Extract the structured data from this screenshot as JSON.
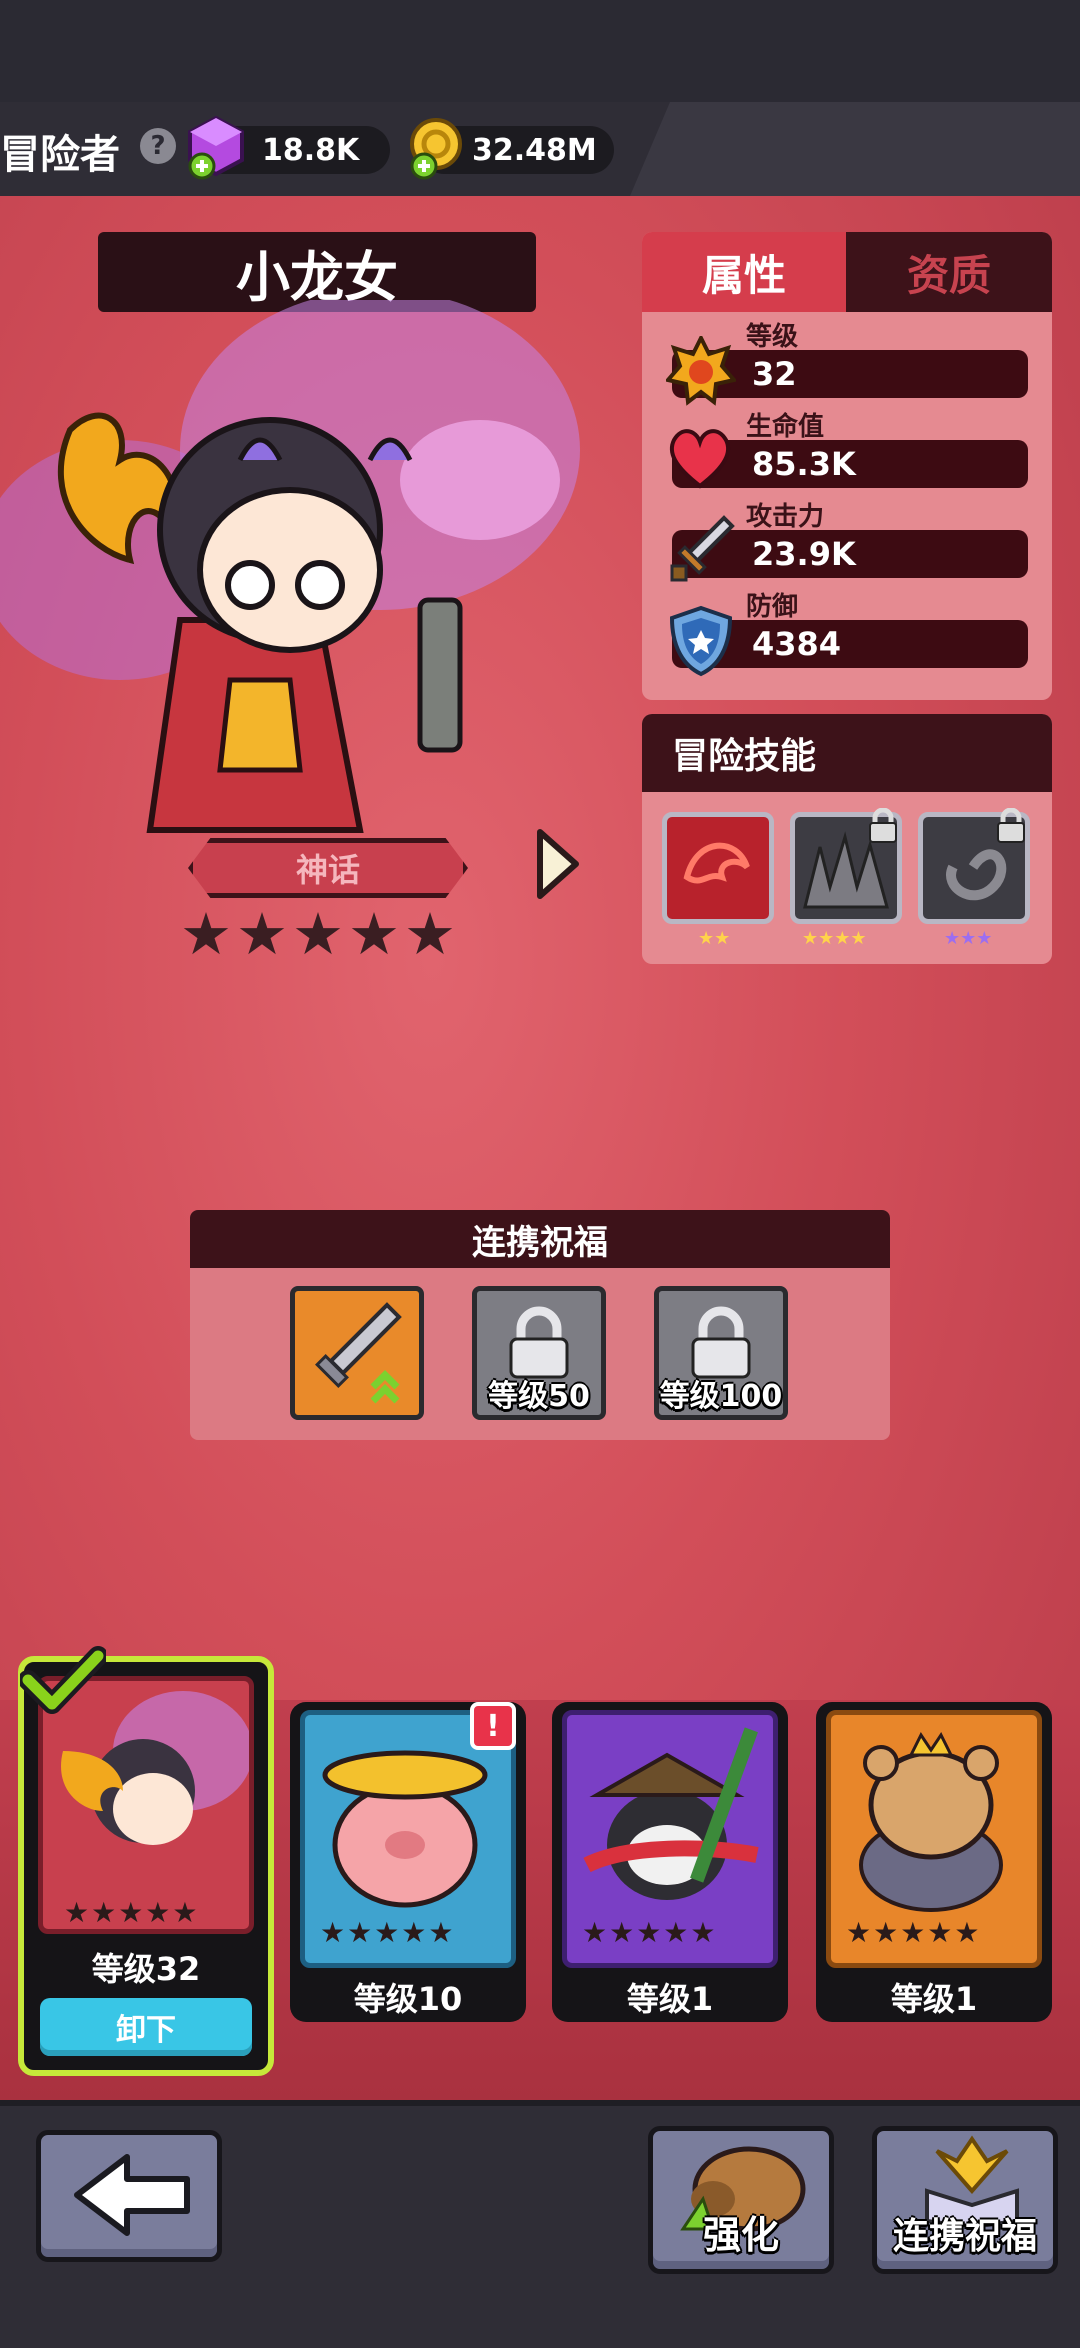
{
  "header": {
    "title": "冒险者",
    "help_icon": "question-icon",
    "gems": "18.8K",
    "coins": "32.48M"
  },
  "hero": {
    "name": "小龙女",
    "rarity": "神话",
    "stars": "★★★★★"
  },
  "stats_panel": {
    "tabs": [
      "属性",
      "资质"
    ],
    "rows": [
      {
        "label": "等级",
        "value": "32",
        "icon": "sun-badge-icon"
      },
      {
        "label": "生命值",
        "value": "85.3K",
        "icon": "heart-icon"
      },
      {
        "label": "攻击力",
        "value": "23.9K",
        "icon": "sword-icon"
      },
      {
        "label": "防御",
        "value": "4384",
        "icon": "shield-icon"
      }
    ]
  },
  "skills_panel": {
    "title": "冒险技能",
    "skills": [
      {
        "icon": "dragon-skill-icon",
        "stars": "★★",
        "locked": false
      },
      {
        "icon": "spikes-skill-icon",
        "stars": "★★★★",
        "locked": true
      },
      {
        "icon": "swirl-skill-icon",
        "stars": "★★★",
        "locked": true
      }
    ]
  },
  "blessing_panel": {
    "title": "连携祝福",
    "slots": [
      {
        "icon": "sword-upgrade-icon",
        "label": ""
      },
      {
        "icon": "lock-icon",
        "label": "等级50"
      },
      {
        "icon": "lock-icon",
        "label": "等级100"
      }
    ]
  },
  "hero_cards": [
    {
      "name": "dragon-girl",
      "level": "等级32",
      "action": "卸下",
      "selected": true
    },
    {
      "name": "pig",
      "level": "等级10",
      "badge": "!"
    },
    {
      "name": "panda",
      "level": "等级1"
    },
    {
      "name": "bear",
      "level": "等级1"
    }
  ],
  "bottom_bar": {
    "back_icon": "back-arrow-icon",
    "upgrade_label": "强化",
    "bless_label": "连携祝福"
  },
  "colors": {
    "accent_red": "#d53d4c",
    "panel_pink": "#e58a91",
    "dark_maroon": "#3d1219",
    "select_green": "#c6e83a",
    "button_cyan": "#39c6e6"
  }
}
